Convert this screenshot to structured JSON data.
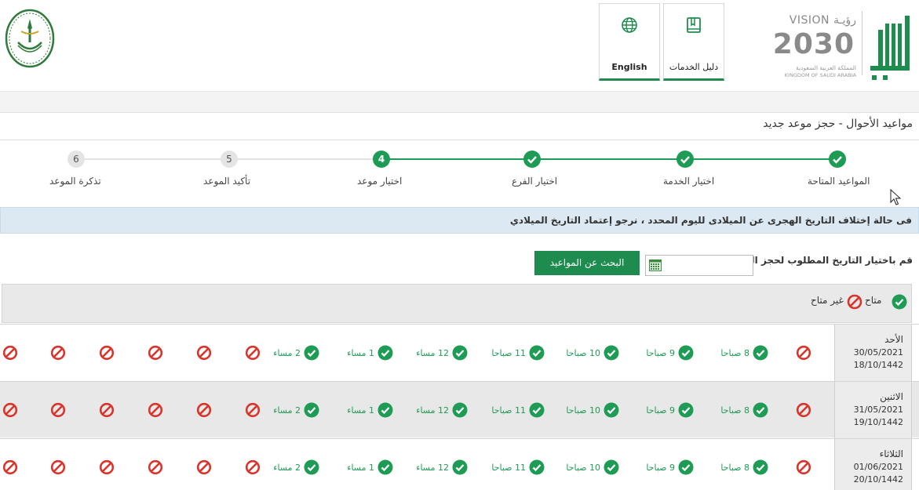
{
  "header": {
    "guide_label": "دليل الخدمات",
    "english_label": "English",
    "vision_top": "VISION رؤيـة",
    "vision_year": "2030",
    "vision_ar": "المملكة العربية السعودية",
    "vision_en": "KINGDOM OF SAUDI ARABIA"
  },
  "page": {
    "title": "مواعيد الأحوال - حجز موعد جديد"
  },
  "stepper": {
    "steps": [
      {
        "label": "المواعيد المتاحة",
        "state": "done",
        "num": ""
      },
      {
        "label": "اختيار الخدمة",
        "state": "done",
        "num": ""
      },
      {
        "label": "اختيار الفرع",
        "state": "done",
        "num": ""
      },
      {
        "label": "اختيار موعد",
        "state": "current",
        "num": "4"
      },
      {
        "label": "تأكيد الموعد",
        "state": "pending",
        "num": "5"
      },
      {
        "label": "تذكرة الموعد",
        "state": "pending",
        "num": "6"
      }
    ]
  },
  "notice": "فى حالة إختلاف التاريخ الهجرى عن الميلادى لليوم المحدد ، نرجو إعتماد التاريخ الميلادي",
  "search": {
    "label": "قم باختيار التاريخ المطلوب لحجز الموعد :",
    "date_value": "",
    "button_label": "البحث عن المواعيد"
  },
  "legend": {
    "available": "متاح",
    "unavailable": "غير متاح"
  },
  "slots": [
    "8 صباحا",
    "9 صباحا",
    "10 صباحا",
    "11 صباحا",
    "12 مساء",
    "1 مساء",
    "2 مساء"
  ],
  "days": [
    {
      "name": "الأحد",
      "gregorian": "30/05/2021",
      "hijri": "18/10/1442"
    },
    {
      "name": "الاثنين",
      "gregorian": "31/05/2021",
      "hijri": "19/10/1442"
    },
    {
      "name": "الثلاثاء",
      "gregorian": "01/06/2021",
      "hijri": "20/10/1442"
    }
  ],
  "colors": {
    "brand_green": "#1e9b55",
    "unavailable_red": "#d9342b",
    "notice_blue": "#dce9f3"
  }
}
